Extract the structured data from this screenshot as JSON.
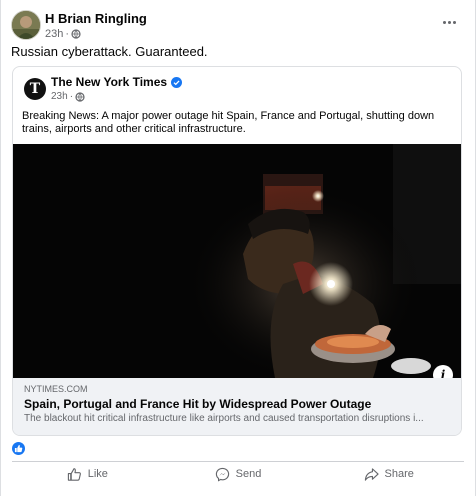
{
  "post": {
    "author": "H Brian Ringling",
    "time": "23h",
    "separator": "·",
    "text": "Russian cyberattack. Guaranteed.",
    "more_icon": "more-horizontal-icon",
    "privacy_icon": "globe-icon"
  },
  "shared": {
    "page_name": "The New York Times",
    "logo_letter": "T",
    "verified_icon": "verified-badge-icon",
    "time": "23h",
    "separator": "·",
    "text": "Breaking News: A major power outage hit Spain, France and Portugal, shutting down trains, airports and other critical infrastructure.",
    "link": {
      "domain": "NYTIMES.COM",
      "title": "Spain, Portugal and France Hit by Widespread Power Outage",
      "description": "The blackout hit critical infrastructure like airports and caused transportation disruptions i..."
    },
    "info_label": "i"
  },
  "reactions": {
    "icon": "like-reaction-icon"
  },
  "actions": [
    {
      "label": "Like",
      "icon": "thumbs-up-icon"
    },
    {
      "label": "Send",
      "icon": "messenger-icon"
    },
    {
      "label": "Share",
      "icon": "share-icon"
    }
  ],
  "colors": {
    "accent": "#1877f2",
    "secondary_text": "#65676b",
    "link_bg": "#f0f2f5"
  }
}
